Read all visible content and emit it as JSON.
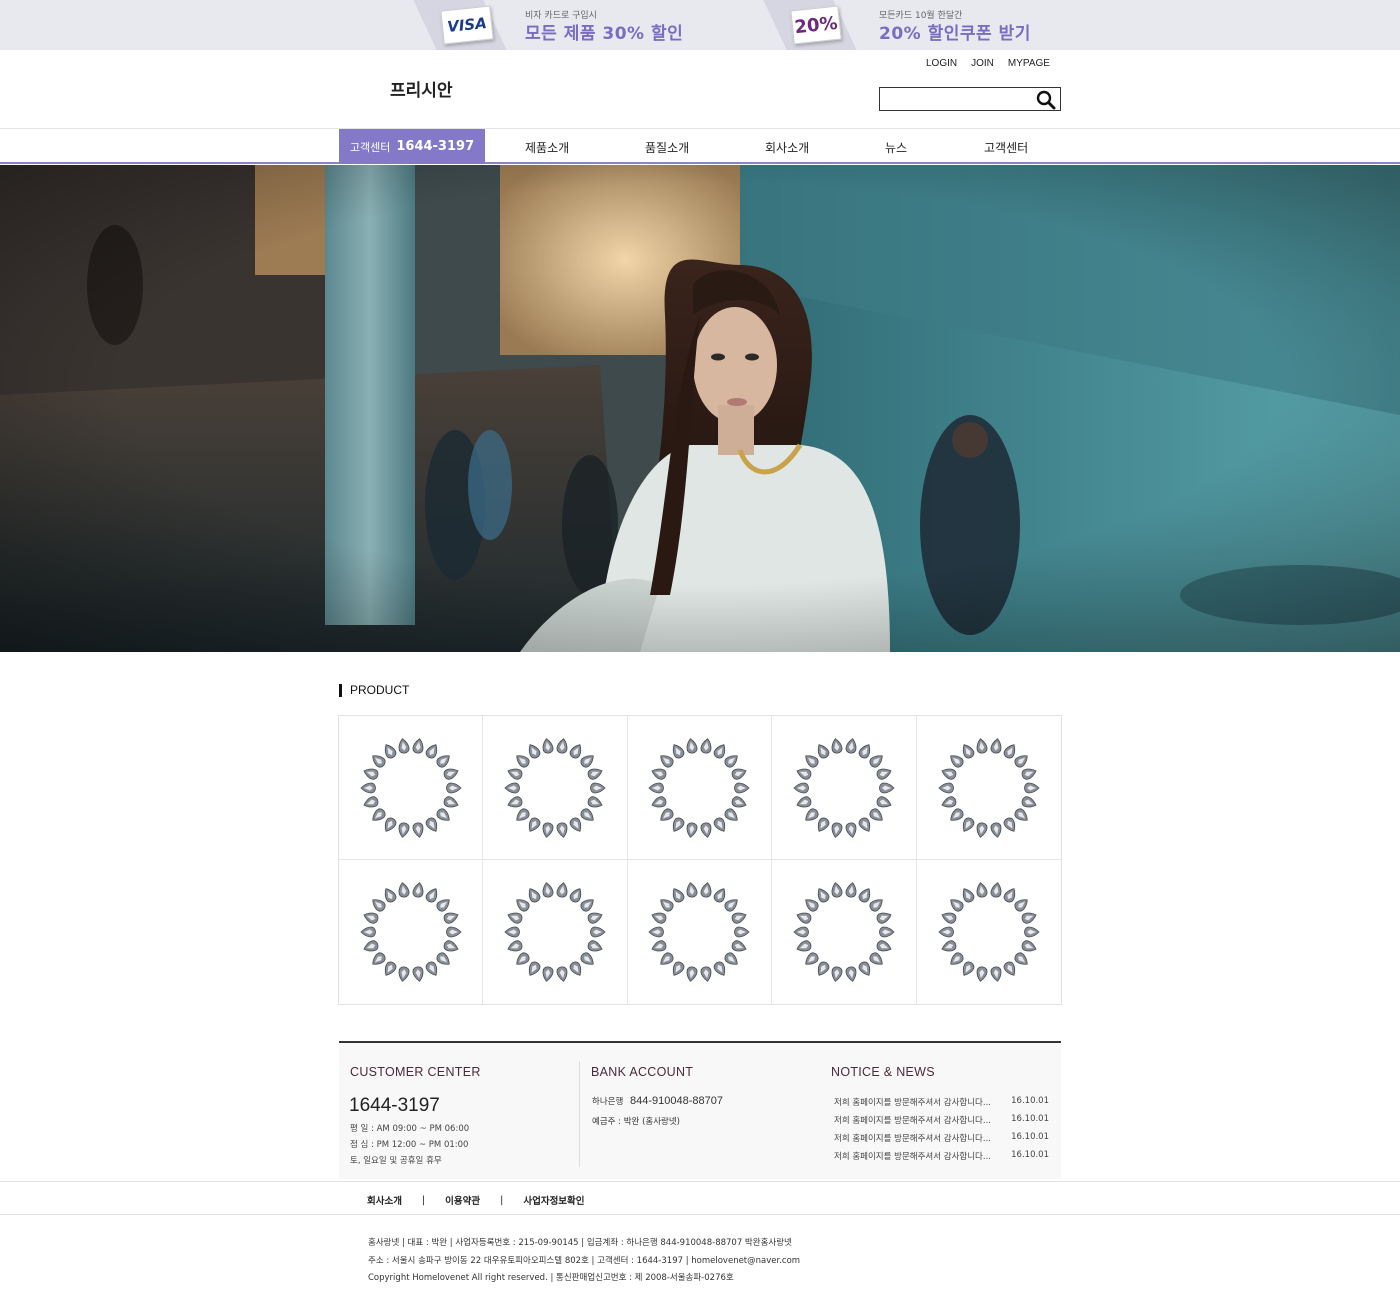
{
  "promo": {
    "left_card": "VISA",
    "left_small": "비자 카드로 구입시",
    "left_big": "모든 제품 30% 할인",
    "right_card": "20%",
    "right_small": "모든카드 10월 한달간",
    "right_big": "20% 할인쿠폰 받기"
  },
  "header": {
    "logo": "프리시안",
    "util_links": [
      "LOGIN",
      "JOIN",
      "MYPAGE"
    ],
    "search_placeholder": ""
  },
  "nav": {
    "cs_label": "고객센터",
    "cs_number": "1644-3197",
    "items": [
      "제품소개",
      "품질소개",
      "회사소개",
      "뉴스",
      "고객센터"
    ]
  },
  "product": {
    "title": "PRODUCT",
    "item_count_shown": 10
  },
  "info": {
    "customer": {
      "title": "CUSTOMER CENTER",
      "phone": "1644-3197",
      "hours": [
        "평 일 : AM 09:00 ~ PM 06:00",
        "점 심 : PM 12:00 ~ PM 01:00",
        "토, 일요일 및 공휴일 휴무"
      ]
    },
    "bank": {
      "title": "BANK ACCOUNT",
      "bank_name": "하나은행",
      "account": "844-910048-88707",
      "holder": "예금주 : 박완 (홈사랑넷)"
    },
    "notice": {
      "title": "NOTICE & NEWS",
      "items": [
        {
          "text": "저희 홈페이지를 방문해주셔서 감사합니다...",
          "date": "16.10.01"
        },
        {
          "text": "저희 홈페이지를 방문해주셔서 감사합니다...",
          "date": "16.10.01"
        },
        {
          "text": "저희 홈페이지를 방문해주셔서 감사합니다...",
          "date": "16.10.01"
        },
        {
          "text": "저희 홈페이지를 방문해주셔서 감사합니다...",
          "date": "16.10.01"
        }
      ]
    }
  },
  "footer": {
    "links": [
      "회사소개",
      "이용약관",
      "사업자정보확인"
    ],
    "separator": "|",
    "company_lines": [
      "홈사랑넷  |  대표 : 박완  |  사업자등록번호 : 215-09-90145  |  입금계좌 : 하나은행 844-910048-88707 박완홈사랑넷",
      "주소 : 서울시 송파구 방이동 22 대우유토피아오피스텔 802호  |  고객센터 : 1644-3197  |  homelovenet@naver.com",
      "Copyright Homelovenet All right reserved.  |  통신판매업신고번호 : 제 2008-서울송파-0276호"
    ]
  },
  "colors": {
    "accent": "#8478c8",
    "promo_bg": "#e8e8ef",
    "promo_text": "#7a6cc2",
    "info_heading": "#4a2a3a"
  }
}
